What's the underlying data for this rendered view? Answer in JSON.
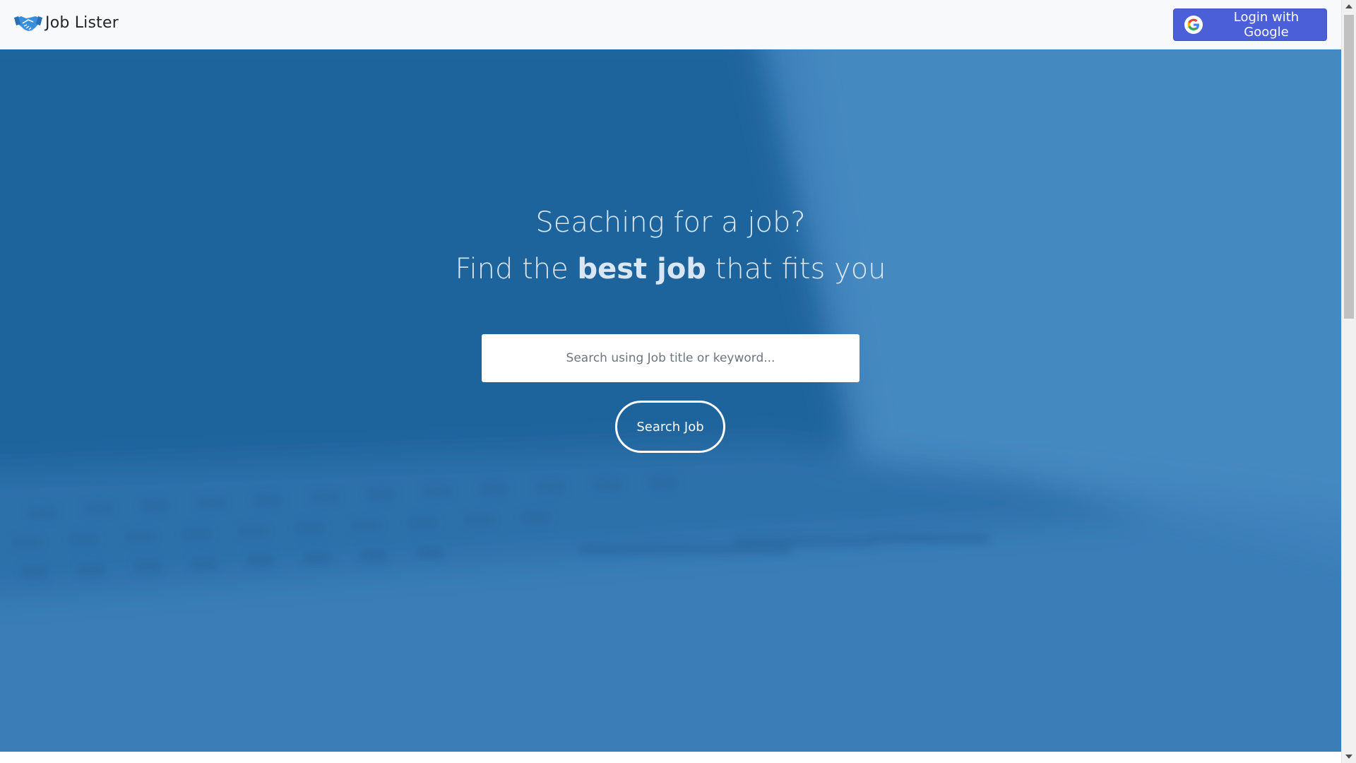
{
  "navbar": {
    "brand": "Job Lister",
    "brand_icon": "handshake-icon",
    "login_label": "Login with Google",
    "login_icon": "google-icon",
    "login_color": "#4b5fd8"
  },
  "hero": {
    "headline_line1": "Seaching for a job?",
    "headline_line2_prefix": "Find the ",
    "headline_line2_bold": "best job",
    "headline_line2_suffix": " that fits you",
    "search_placeholder": "Search using Job title or keyword...",
    "search_value": "",
    "search_button_label": "Search Job",
    "background_color": "#2f73ab"
  },
  "colors": {
    "accent": "#4b5fd8",
    "hero_overlay": "#2a6aa3",
    "headline_text": "#d9e7f4",
    "brand_icon": "#3a8fdc"
  }
}
